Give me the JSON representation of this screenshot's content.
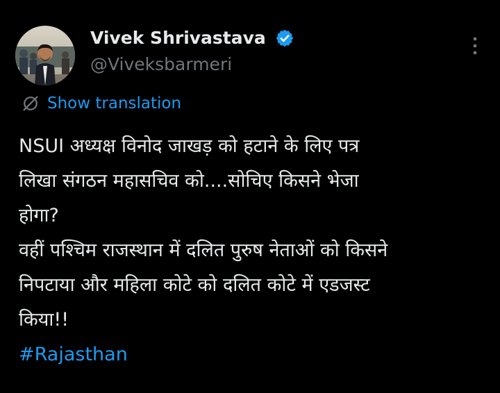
{
  "tweet": {
    "author": {
      "display_name": "Vivek Shrivastava",
      "handle": "@Viveksbarmeri",
      "verified": true,
      "avatar_icon": "person-photo"
    },
    "more_icon": "more-dots-icon",
    "translate": {
      "icon": "translate-icon",
      "label": "Show translation"
    },
    "body_lines": [
      "NSUI अध्यक्ष विनोद जाखड़ को हटाने के लिए पत्र",
      "लिखा संगठन महासचिव को....सोचिए किसने भेजा",
      "होगा?",
      "वहीं पश्चिम राजस्थान में दलित पुरुष नेताओं को किसने",
      "निपटाया और महिला कोटे को दलित कोटे में एडजस्ट",
      "किया!!"
    ],
    "hashtag": "#Rajasthan"
  },
  "colors": {
    "background": "#000000",
    "text_primary": "#e7e9ea",
    "text_secondary": "#71767b",
    "accent": "#1d9bf0"
  }
}
